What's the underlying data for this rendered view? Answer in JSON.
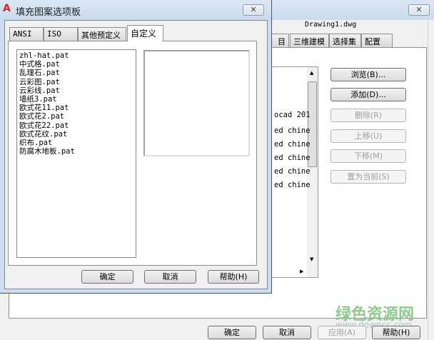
{
  "back_dialog": {
    "close_label": "✕",
    "drawing_name": "Drawing1.dwg",
    "tabs": [
      "目",
      "三维建模",
      "选择集",
      "配置"
    ],
    "list_rows": [
      "ocad 201",
      "ed chine",
      "ed chine",
      "ed chine",
      "ed chine",
      "ed chine"
    ],
    "side_buttons": [
      {
        "label": "浏览(B)...",
        "enabled": true
      },
      {
        "label": "添加(D)...",
        "enabled": true
      },
      {
        "label": "删除(R)",
        "enabled": false
      },
      {
        "label": "上移(U)",
        "enabled": false
      },
      {
        "label": "下移(M)",
        "enabled": false
      },
      {
        "label": "置为当前(S)",
        "enabled": false
      }
    ],
    "footer": {
      "ok": "确定",
      "cancel": "取消",
      "apply": "应用(A)",
      "help": "帮助(H)"
    }
  },
  "front_dialog": {
    "title": "填充图案选项板",
    "close_label": "✕",
    "tabs": [
      "ANSI",
      "ISO",
      "其他预定义",
      "自定义"
    ],
    "selected_tab": "自定义",
    "patterns": [
      "zhl-hat.pat",
      "中式格.pat",
      "乱理石.pat",
      "云彩图.pat",
      "云彩线.pat",
      "墙纸3.pat",
      "欧式花11.pat",
      "欧式花2.pat",
      "欧式花22.pat",
      "欧式花纹.pat",
      "织布.pat",
      "防腐木地板.pat"
    ],
    "footer": {
      "ok": "确定",
      "cancel": "取消",
      "help": "帮助(H)"
    }
  },
  "watermark": {
    "title": "绿色资源网",
    "url": "www.downcc.com"
  }
}
